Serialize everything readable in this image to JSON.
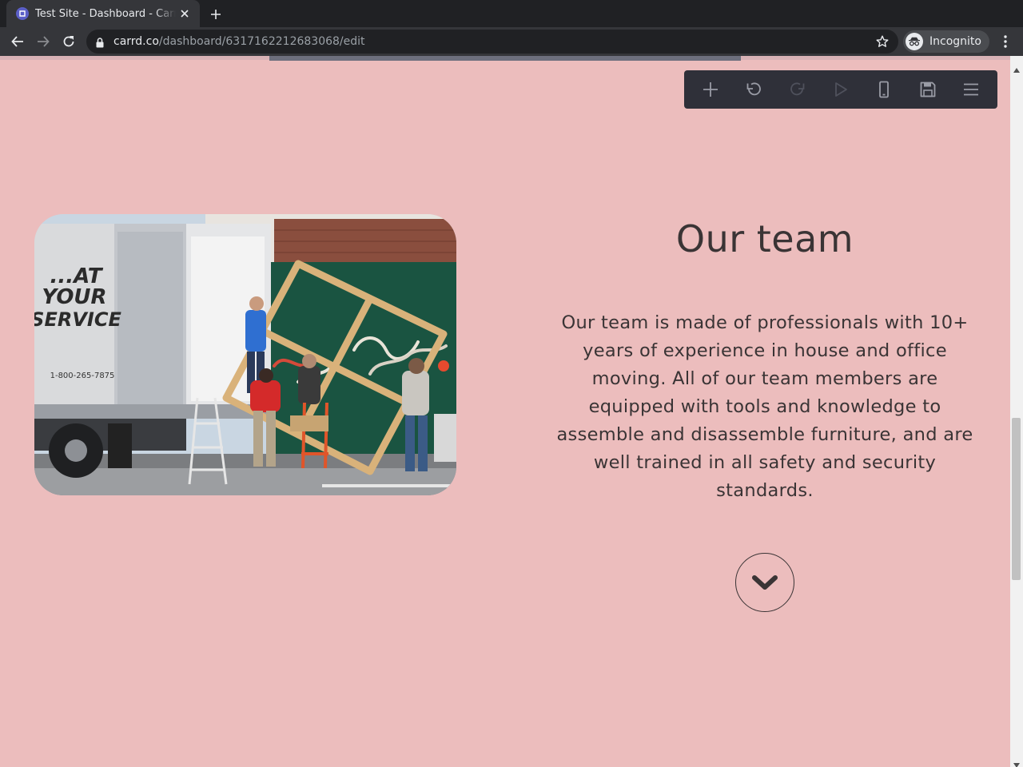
{
  "browser": {
    "tab_title": "Test Site - Dashboard - Carrd",
    "url_host": "carrd.co",
    "url_path": "/dashboard/6317162212683068/edit",
    "incognito_label": "Incognito"
  },
  "editor_toolbar": {
    "buttons": [
      "add-icon",
      "undo-icon",
      "redo-icon",
      "play-icon",
      "mobile-icon",
      "save-icon",
      "menu-icon"
    ]
  },
  "content": {
    "heading": "Our team",
    "body": "Our team is made of professionals with 10+ years of experience in house and office moving. All of our team members are equipped with tools and knowledge to assemble and disassemble furniture, and are well trained in all safety and security standards.",
    "image": {
      "truck_text": "...AT YOUR SERVICE",
      "phone_text": "1-800-265-7875"
    }
  },
  "colors": {
    "page_background": "#ecbdbd",
    "text": "#3a3435",
    "editor_toolbar": "#2f3039",
    "chrome_dark": "#202124",
    "chrome_bar": "#35363a"
  }
}
